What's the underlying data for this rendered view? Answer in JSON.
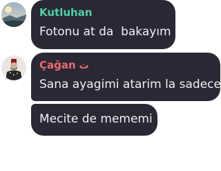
{
  "messages": [
    {
      "sender": "Kutluhan",
      "sender_color": "#4fd1a5",
      "text": "Fotonu at da  bakayım",
      "avatar": "landscape-avatar"
    },
    {
      "sender": "Çağan",
      "sender_badge": "ت",
      "sender_color": "#ec6b6b",
      "text": "Sana ayagimi atarim la sadece",
      "avatar": "portrait-avatar"
    },
    {
      "text": "Mecite de mememi"
    }
  ],
  "colors": {
    "bubble": "#2a2835",
    "text": "#f0f0f4"
  }
}
